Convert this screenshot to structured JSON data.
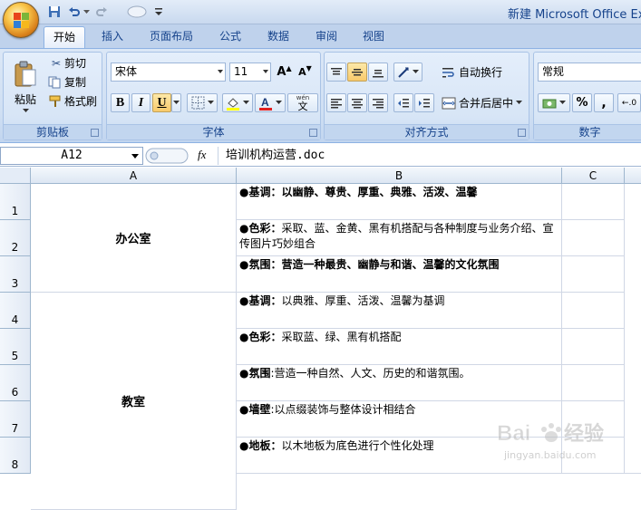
{
  "window": {
    "title": "新建 Microsoft Office Excel"
  },
  "ribbon_tabs": [
    "开始",
    "插入",
    "页面布局",
    "公式",
    "数据",
    "审阅",
    "视图"
  ],
  "clipboard": {
    "paste": "粘贴",
    "cut": "剪切",
    "copy": "复制",
    "format_painter": "格式刷",
    "label": "剪贴板"
  },
  "font": {
    "name": "宋体",
    "size": "11",
    "bold": "B",
    "italic": "I",
    "underline": "U",
    "phonetic": "wén",
    "label": "字体"
  },
  "alignment": {
    "wrap": "自动换行",
    "merge": "合并后居中",
    "label": "对齐方式"
  },
  "number": {
    "format": "常规",
    "percent": "%",
    "comma": ",",
    "label": "数字"
  },
  "formula_bar": {
    "name_box": "A12",
    "fx": "fx",
    "content": "培训机构运营.doc"
  },
  "columns": [
    "A",
    "B",
    "C"
  ],
  "rows": [
    "1",
    "2",
    "3",
    "4",
    "5",
    "6",
    "7",
    "8"
  ],
  "sheet": {
    "a1_3": "办公室",
    "a4_8": "教室",
    "b": [
      {
        "key": "●基调：",
        "text": "以幽静、尊贵、厚重、典雅、活泼、温馨",
        "all_bold": true
      },
      {
        "key": "●色彩：",
        "text": "采取、蓝、金黄、黑有机搭配与各种制度与业务介绍、宣传图片巧妙组合",
        "all_bold": false
      },
      {
        "key": "●氛围：",
        "text": "营造一种最贵、幽静与和谐、温馨的文化氛围",
        "all_bold": true
      },
      {
        "key": "●基调：",
        "text": "以典雅、厚重、活泼、温馨为基调",
        "all_bold": false
      },
      {
        "key": "●色彩：",
        "text": "采取蓝、绿、黑有机搭配",
        "all_bold": false
      },
      {
        "key": "●氛围",
        "text": ":营造一种自然、人文、历史的和谐氛围。",
        "all_bold": false
      },
      {
        "key": "●墙壁",
        "text": ":以点缀装饰与整体设计相结合",
        "all_bold": false
      },
      {
        "key": "●地板：",
        "text": "以木地板为底色进行个性化处理",
        "all_bold": false
      }
    ]
  },
  "watermark": {
    "brand": "Baidu 经验",
    "url": "jingyan.baidu.com"
  },
  "colors": {
    "accent": "#15428b",
    "ribbon": "#d7e5f6",
    "grid": "#d0d7e5"
  }
}
